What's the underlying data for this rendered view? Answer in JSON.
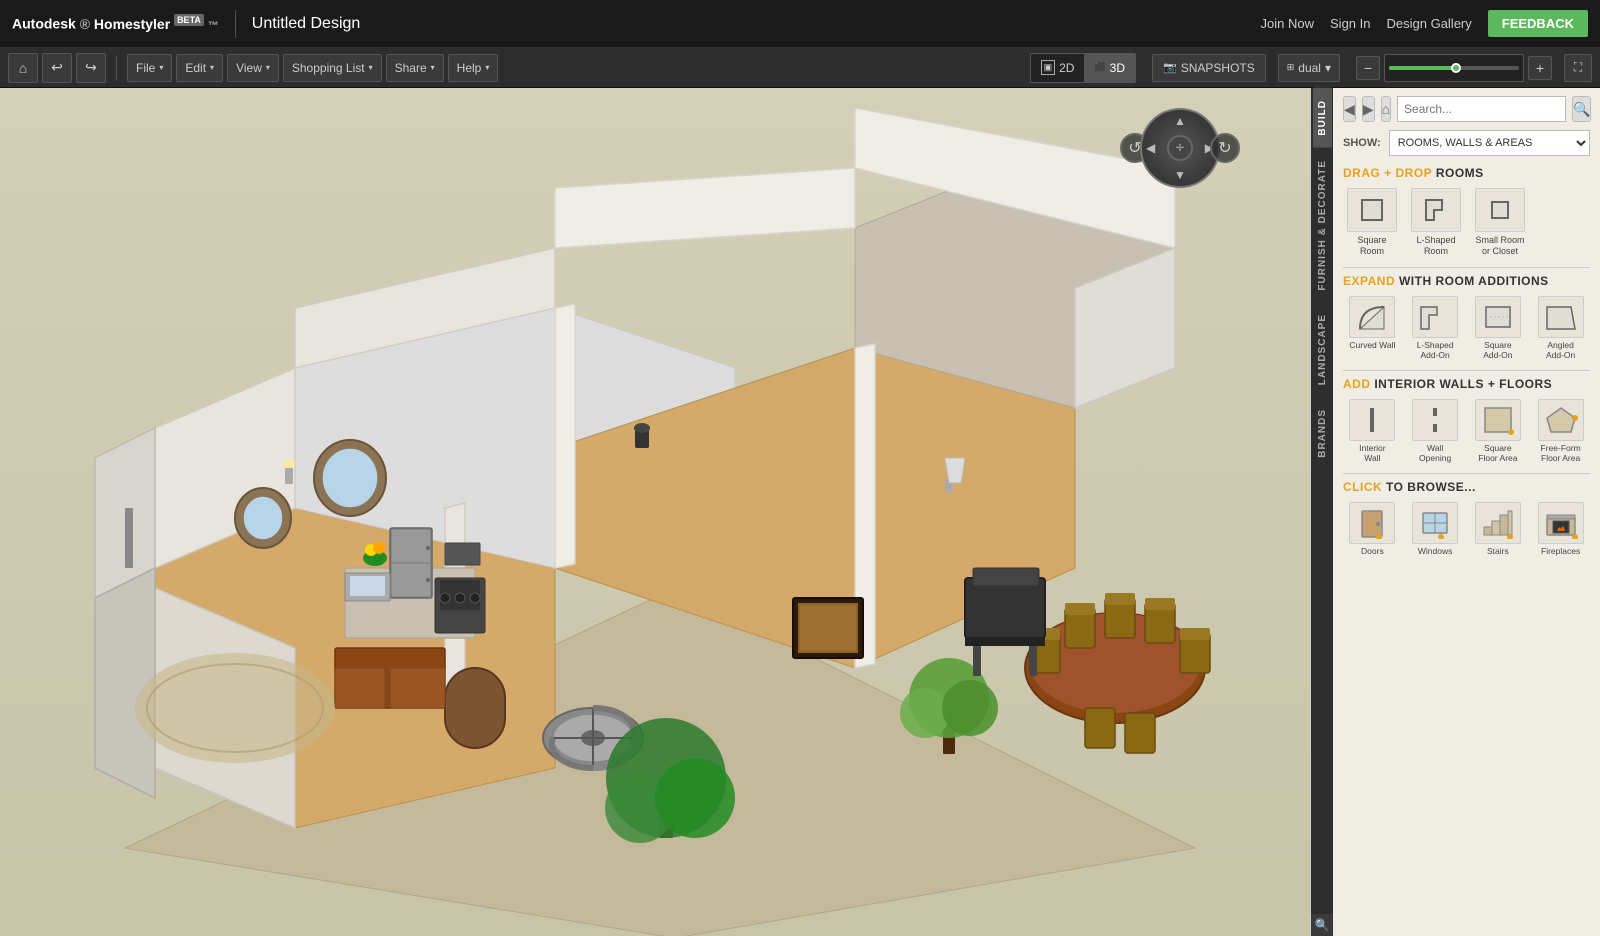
{
  "app": {
    "name": "Autodesk",
    "product": "Homestyler",
    "beta_label": "BETA",
    "design_title": "Untitled Design"
  },
  "header_nav": {
    "join_now": "Join Now",
    "sign_in": "Sign In",
    "design_gallery": "Design Gallery",
    "feedback": "FEEDBACK"
  },
  "toolbar": {
    "home_icon": "⌂",
    "undo_icon": "↩",
    "redo_icon": "↪",
    "file_label": "File",
    "edit_label": "Edit",
    "view_label": "View",
    "shopping_list_label": "Shopping List",
    "share_label": "Share",
    "help_label": "Help",
    "arrow": "▾",
    "mode_2d": "2D",
    "mode_3d": "3D",
    "mode_3d_active": true,
    "snapshots_label": "SNAPSHOTS",
    "dual_label": "dual",
    "zoom_minus": "−",
    "zoom_plus": "+",
    "fullscreen": "⛶"
  },
  "sidebar": {
    "tabs": [
      {
        "id": "build",
        "label": "BUILD",
        "active": true
      },
      {
        "id": "furnish",
        "label": "FURNISH & DECORATE",
        "active": false
      },
      {
        "id": "landscape",
        "label": "LANDSCAPE",
        "active": false
      },
      {
        "id": "brands",
        "label": "BRANDS",
        "active": false
      }
    ],
    "search_placeholder": "Search...",
    "show_label": "SHOW:",
    "show_options": [
      "ROOMS, WALLS & AREAS"
    ],
    "show_selected": "ROOMS, WALLS & AREAS",
    "sections": {
      "drag_drop_rooms": {
        "prefix": "DRAG + DROP",
        "suffix": "ROOMS",
        "items": [
          {
            "id": "square-room",
            "label": "Square\nRoom"
          },
          {
            "id": "l-shaped-room",
            "label": "L-Shaped\nRoom"
          },
          {
            "id": "small-room",
            "label": "Small Room\nor Closet"
          }
        ]
      },
      "expand_rooms": {
        "prefix": "EXPAND",
        "suffix": "WITH ROOM ADDITIONS",
        "items": [
          {
            "id": "curved-wall",
            "label": "Curved Wall"
          },
          {
            "id": "l-shaped-addon",
            "label": "L-Shaped\nAdd-On"
          },
          {
            "id": "square-addon",
            "label": "Square\nAdd-On"
          },
          {
            "id": "angled-addon",
            "label": "Angled\nAdd-On"
          }
        ]
      },
      "interior_walls": {
        "prefix": "ADD",
        "suffix": "INTERIOR WALLS + FLOORS",
        "items": [
          {
            "id": "interior-wall",
            "label": "Interior\nWall"
          },
          {
            "id": "wall-opening",
            "label": "Wall\nOpening"
          },
          {
            "id": "square-floor",
            "label": "Square\nFloor Area"
          },
          {
            "id": "freeform-floor",
            "label": "Free-Form\nFloor Area"
          }
        ]
      },
      "click_browse": {
        "prefix": "CLICK",
        "suffix": "TO BROWSE...",
        "items": [
          {
            "id": "doors",
            "label": "Doors"
          },
          {
            "id": "windows",
            "label": "Windows"
          },
          {
            "id": "stairs",
            "label": "Stairs"
          },
          {
            "id": "fireplaces",
            "label": "Fireplaces"
          }
        ]
      }
    }
  },
  "nav_control": {
    "rotate_left": "↺",
    "rotate_right": "↻",
    "arrow_up": "▲",
    "arrow_down": "▼",
    "arrow_left": "◀",
    "arrow_right": "▶",
    "center": "✛"
  }
}
